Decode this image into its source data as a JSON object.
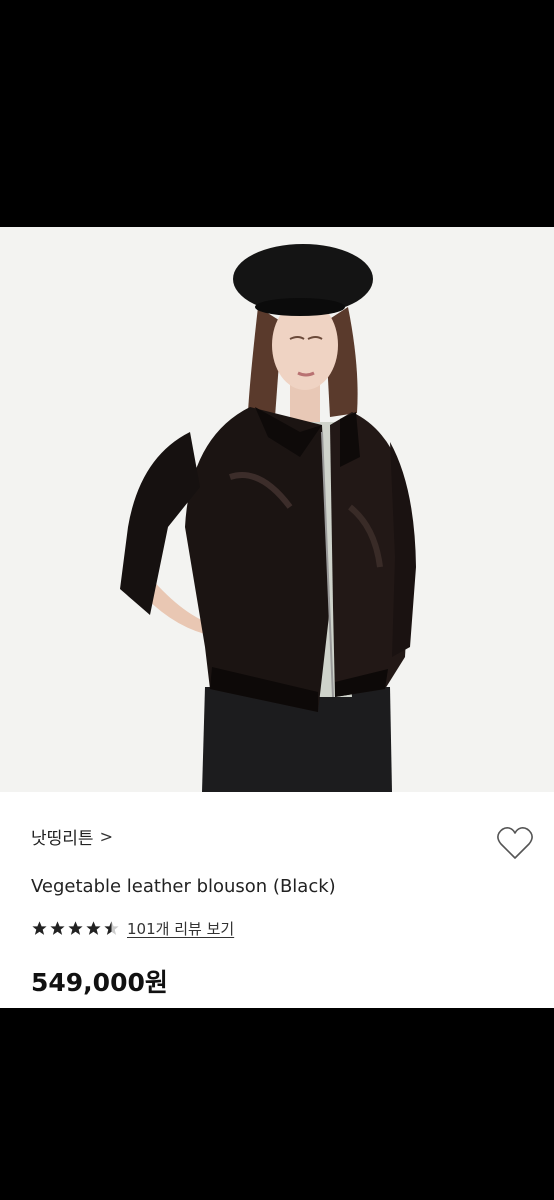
{
  "product": {
    "image_alt": "model wearing black leather blouson and beret",
    "brand": "낫띵리튼",
    "brand_chevron": ">",
    "name": "Vegetable leather blouson (Black)",
    "rating": 4.5,
    "review_link": "101개 리뷰 보기",
    "price": "549,000원",
    "wishlist_icon": "heart-outline-icon"
  },
  "colors": {
    "background": "#000000",
    "photo_bg": "#f3f3f1",
    "panel_bg": "#ffffff",
    "text": "#222222",
    "heart_stroke": "#555555"
  }
}
